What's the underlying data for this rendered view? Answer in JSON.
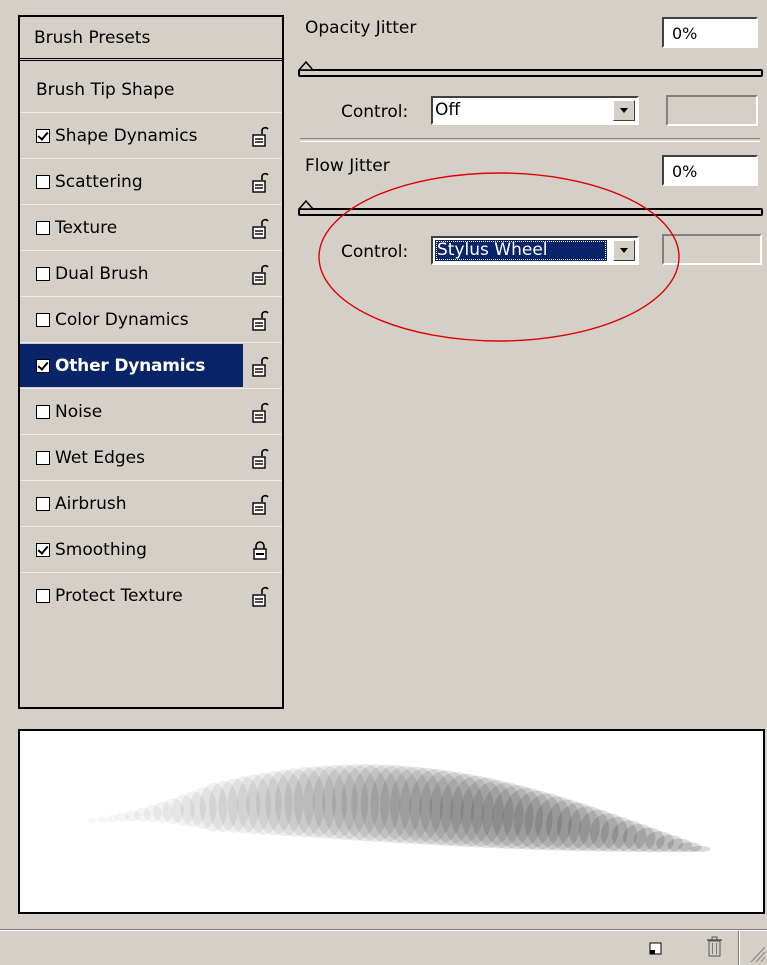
{
  "brush_list": {
    "presets_label": "Brush Presets",
    "tip_shape_label": "Brush Tip Shape",
    "items": [
      {
        "label": "Shape Dynamics",
        "checked": true,
        "lock": "unlocked"
      },
      {
        "label": "Scattering",
        "checked": false,
        "lock": "unlocked"
      },
      {
        "label": "Texture",
        "checked": false,
        "lock": "unlocked"
      },
      {
        "label": "Dual Brush",
        "checked": false,
        "lock": "unlocked"
      },
      {
        "label": "Color Dynamics",
        "checked": false,
        "lock": "unlocked"
      },
      {
        "label": "Other Dynamics",
        "checked": true,
        "lock": "unlocked",
        "selected": true
      },
      {
        "label": "Noise",
        "checked": false,
        "lock": "unlocked"
      },
      {
        "label": "Wet Edges",
        "checked": false,
        "lock": "unlocked"
      },
      {
        "label": "Airbrush",
        "checked": false,
        "lock": "unlocked"
      },
      {
        "label": "Smoothing",
        "checked": true,
        "lock": "locked"
      },
      {
        "label": "Protect Texture",
        "checked": false,
        "lock": "unlocked"
      }
    ]
  },
  "opacity": {
    "label": "Opacity Jitter",
    "value": "0%",
    "slider_fraction": 0,
    "control_label": "Control:",
    "control_value": "Off"
  },
  "flow": {
    "label": "Flow Jitter",
    "value": "0%",
    "slider_fraction": 0,
    "control_label": "Control:",
    "control_value": "Stylus Wheel"
  },
  "annotation": {
    "color": "#e00000"
  },
  "colors": {
    "selection": "#0a246a",
    "panel": "#d4d0c8"
  },
  "footer_icons": [
    "new-brush-icon",
    "trash-icon"
  ]
}
